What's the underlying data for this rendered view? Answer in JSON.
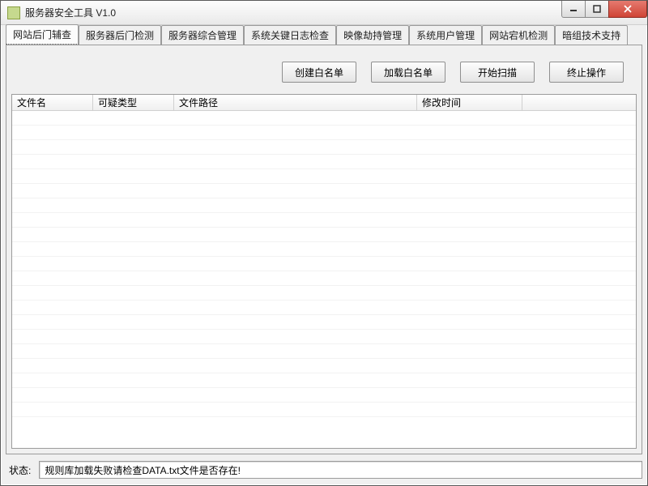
{
  "window": {
    "title": "服务器安全工具 V1.0"
  },
  "tabs": [
    {
      "label": "网站后门辅查",
      "active": true
    },
    {
      "label": "服务器后门检测"
    },
    {
      "label": "服务器综合管理"
    },
    {
      "label": "系统关键日志检查"
    },
    {
      "label": "映像劫持管理"
    },
    {
      "label": "系统用户管理"
    },
    {
      "label": "网站宕机检测"
    },
    {
      "label": "暗组技术支持"
    }
  ],
  "toolbar": {
    "create_whitelist": "创建白名单",
    "load_whitelist": "加载白名单",
    "start_scan": "开始扫描",
    "stop_operation": "终止操作"
  },
  "columns": {
    "file_name": "文件名",
    "suspect_type": "可疑类型",
    "file_path": "文件路径",
    "modified_time": "修改时间"
  },
  "column_widths": {
    "file_name": 100,
    "suspect_type": 100,
    "file_path": 300,
    "modified_time": 130,
    "tail": 120
  },
  "status": {
    "label": "状态:",
    "message": "规则库加载失败请检查DATA.txt文件是否存在!"
  }
}
